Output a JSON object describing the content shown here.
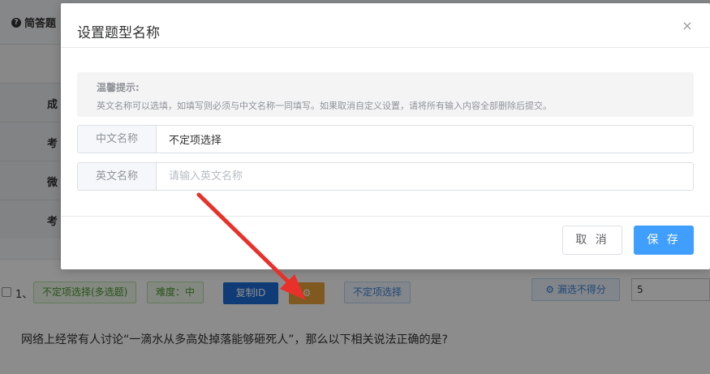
{
  "background": {
    "section_title": "简答题",
    "row_labels": [
      "成",
      "考",
      "微",
      "考"
    ],
    "question": {
      "number": "1、",
      "type_tag": "不定项选择(多选题)",
      "difficulty": "难度：中",
      "copy_id_label": "复制ID",
      "gear_label": "⚙",
      "type_name_tag": "不定项选择",
      "miss_select_label": "⚙ 漏选不得分",
      "score_value": "5",
      "text": "网络上经常有人讨论“一滴水从多高处掉落能够砸死人”，那么以下相关说法正确的是?"
    }
  },
  "modal": {
    "title": "设置题型名称",
    "close_icon": "×",
    "tip": {
      "title": "温馨提示:",
      "text": "英文名称可以选填，如填写则必须与中文名称一同填写。如果取消自定义设置，请将所有输入内容全部删除后提交。"
    },
    "fields": {
      "chinese_label": "中文名称",
      "chinese_value": "不定项选择",
      "english_label": "英文名称",
      "english_placeholder": "请输入英文名称",
      "english_value": ""
    },
    "buttons": {
      "cancel": "取 消",
      "save": "保 存"
    }
  },
  "colors": {
    "primary": "#409eff",
    "copy_button": "#1d6ed8",
    "gear_button": "#e8a33a",
    "arrow": "#e8312a"
  }
}
